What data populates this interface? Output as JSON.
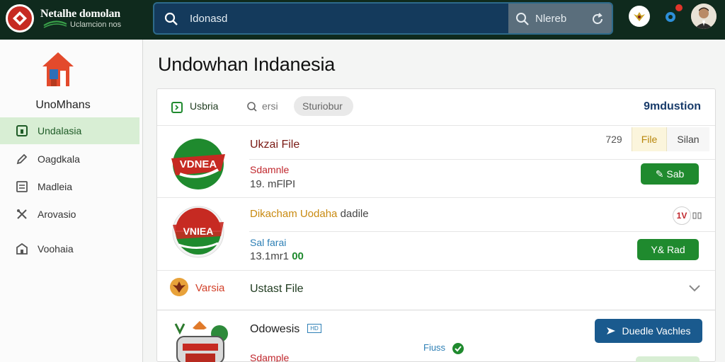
{
  "header": {
    "brand_name": "Netalhe domolan",
    "brand_sub": "Uclamcion nos",
    "search_text": "Idonasd",
    "search_right_text": "Nlereb"
  },
  "sidebar": {
    "title": "UnoMhans",
    "items": [
      {
        "label": "Undalasia",
        "icon": "square-icon"
      },
      {
        "label": "Oagdkala",
        "icon": "pen-icon"
      },
      {
        "label": "Madleia",
        "icon": "list-icon"
      },
      {
        "label": "Arovasio",
        "icon": "tools-icon"
      },
      {
        "label": "Voohaia",
        "icon": "building-icon"
      }
    ]
  },
  "main": {
    "title": "Undowhan Indanesia",
    "tabs": [
      {
        "label": "Usbria"
      },
      {
        "label": "ersi"
      },
      {
        "label": "Sturiobur"
      }
    ],
    "head_right": "9mdustion",
    "mini_table": {
      "count": "729",
      "file": "File",
      "size": "Silan"
    },
    "rows": [
      {
        "emblem_text": "VDNEA",
        "title": "Ukzai File",
        "subtitle": "Sdamnle",
        "meta": "19. mFlPI",
        "button": "✎ Sab"
      },
      {
        "emblem_text": "VNIEA",
        "title_orange": "Dikacham Uodaha",
        "title_rest": " dadile",
        "subtitle": "Sal farai",
        "meta_a": "13.1mr1",
        "meta_b": " 00",
        "badge": "1V",
        "button": "Y& Rad"
      }
    ],
    "expander": {
      "tag": "Varsia",
      "label": "Ustast File"
    },
    "last_row": {
      "title": "Odowesis",
      "title_tag": "HD",
      "subtitle": "Sdample",
      "center_label": "Fiuss",
      "button": "Duedle Vachles"
    }
  },
  "colors": {
    "topbar": "#0f2a1d",
    "search": "#143a5c",
    "active": "#d8eed4",
    "green_button": "#1f8a2e",
    "blue_button": "#1a5a8e"
  }
}
